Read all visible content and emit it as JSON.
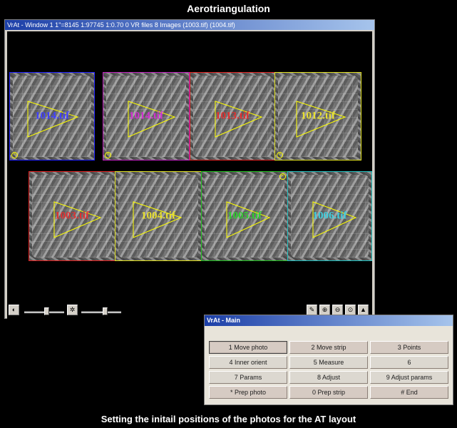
{
  "page_title": "Aerotriangulation",
  "caption": "Setting the initail positions of the photos for the AT layout",
  "main_window": {
    "title": "VrAt - Window 1  1\"=8145  1:97745  1:0.70  0 VR files  8 Images (1003.tif) (1004.tif)",
    "photos": [
      {
        "label": "1014.tif",
        "color": "#2020ff",
        "label_color": "#4040ff"
      },
      {
        "label": "1014.tif",
        "color": "#c020c0",
        "label_color": "#d030d0"
      },
      {
        "label": "1013.tif",
        "color": "#e02020",
        "label_color": "#e03030"
      },
      {
        "label": "1012.tif",
        "color": "#e0e020",
        "label_color": "#e8e030"
      },
      {
        "label": "1003.tif",
        "color": "#e02020",
        "label_color": "#e03030"
      },
      {
        "label": "1004.tif",
        "color": "#e0e020",
        "label_color": "#e8e030"
      },
      {
        "label": "1005.tif",
        "color": "#20c020",
        "label_color": "#30d030"
      },
      {
        "label": "1006.tif",
        "color": "#20c0c0",
        "label_color": "#40d0e0"
      }
    ],
    "toolbar": {
      "contrast_icon": "contrast-icon",
      "brightness_icon": "brightness-icon",
      "pen_icon": "pen-icon",
      "zoom_in_icon": "zoom-in-icon",
      "zoom_out_icon": "zoom-out-icon",
      "zoom_fit_icon": "zoom-fit-icon",
      "image_icon": "image-icon"
    }
  },
  "panel": {
    "title": "VrAt - Main",
    "buttons": [
      {
        "label": "1 Move photo",
        "active": true
      },
      {
        "label": "2 Move strip"
      },
      {
        "label": "3 Points"
      },
      {
        "label": "4 Inner orient"
      },
      {
        "label": "5 Measure"
      },
      {
        "label": "6"
      },
      {
        "label": "7 Params"
      },
      {
        "label": "8 Adjust"
      },
      {
        "label": "9 Adjust params"
      },
      {
        "label": "* Prep photo"
      },
      {
        "label": "0 Prep strip"
      },
      {
        "label": "# End"
      }
    ]
  }
}
